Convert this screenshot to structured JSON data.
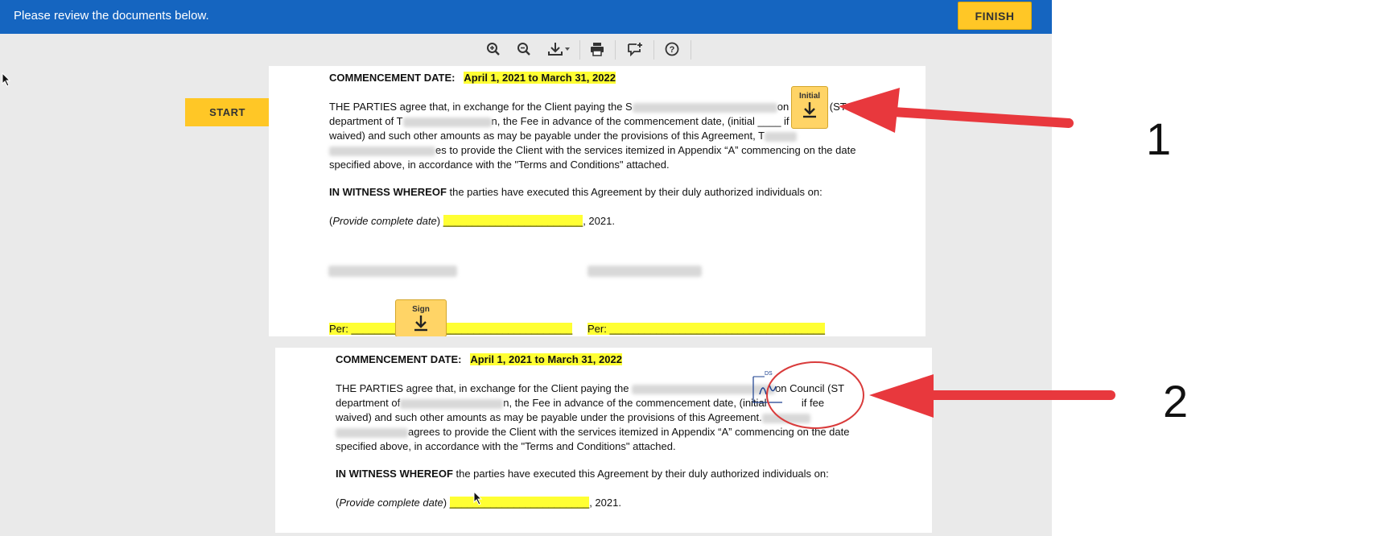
{
  "topbar": {
    "message": "Please review the documents below.",
    "finish_label": "FINISH"
  },
  "toolbar": {
    "icons": [
      "zoom-in-icon",
      "zoom-out-icon",
      "download-icon",
      "print-icon",
      "add-comment-icon",
      "help-icon"
    ]
  },
  "start_label": "START",
  "doc1": {
    "commencement_label": "COMMENCEMENT DATE:",
    "commencement_value": "April 1, 2021 to March 31, 2022",
    "p1_l1a": "THE PARTIES agree that, in exchange for the Client paying the S",
    "p1_l1b": "on Council (ST",
    "p1_l2a": "department of T",
    "p1_l2b": "n, the Fee in advance of the commencement date, (initial ____ if fee",
    "p1_l3": "waived) and such other amounts as may be payable under the provisions of this Agreement, T",
    "p1_l4b": "es to provide the Client with the services itemized in Appendix “A” commencing on the date",
    "p1_l5": "specified above, in accordance with the \"Terms and Conditions\" attached.",
    "witness_bold": "IN WITNESS WHEREOF",
    "witness_rest": " the parties have executed this Agreement by their duly authorized individuals on:",
    "date_italic": "Provide complete date",
    "date_line": "________________________",
    "date_year": ", 2021.",
    "per_label_1": "Per: ",
    "per_line_1": "______________________________________",
    "per_label_2": "Per: ",
    "per_line_2": "_____________________________________",
    "initial_tag": "Initial",
    "sign_tag": "Sign"
  },
  "doc2": {
    "commencement_label": "COMMENCEMENT DATE:",
    "commencement_value": "April 1, 2021 to March 31, 2022",
    "p1_l1a": "THE PARTIES agree that, in exchange for the Client paying the",
    "p1_l1b": "on Council (ST",
    "p1_l2a": "department of",
    "p1_l2b": "n, the Fee in advance of the commencement date, (initial",
    "p1_l2c": "if fee",
    "p1_l3": "waived) and such other amounts as may be payable under the provisions of this Agreement.",
    "p1_l4b": "agrees to provide the Client with the services itemized in Appendix “A” commencing on the date",
    "p1_l5": "specified above, in accordance with the \"Terms and Conditions\" attached.",
    "witness_bold": "IN WITNESS WHEREOF",
    "witness_rest": " the parties have executed this Agreement by their duly authorized individuals on:",
    "date_italic": "Provide complete date",
    "date_line": "________________________",
    "date_year": ", 2021.",
    "ds_label": "DS"
  },
  "annotations": {
    "label_1": "1",
    "label_2": "2",
    "arrow_color": "#e8383d"
  }
}
